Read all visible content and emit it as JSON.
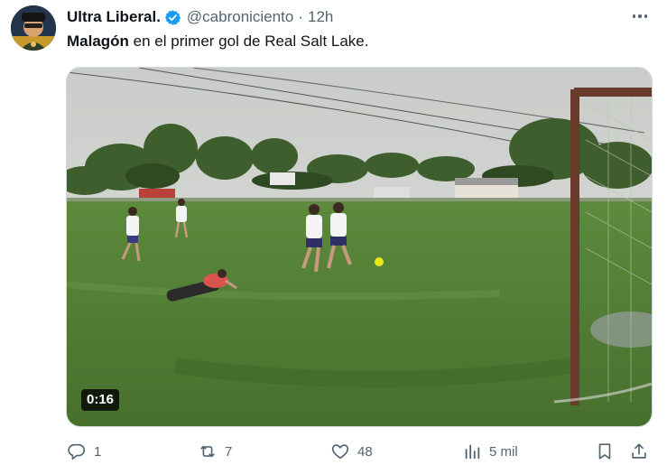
{
  "tweet": {
    "display_name": "Ultra Liberal.",
    "handle": "@cabroniciento",
    "separator": "·",
    "time": "12h",
    "text_bold": "Malagón",
    "text_rest": " en el primer gol de Real Salt Lake."
  },
  "media": {
    "duration": "0:16"
  },
  "actions": {
    "replies": "1",
    "reposts": "7",
    "likes": "48",
    "views": "5 mil"
  },
  "colors": {
    "verified": "#1d9bf0",
    "text_secondary": "#536471",
    "field_green": "#4f7a34"
  },
  "icons": [
    "verified-badge-icon",
    "more-icon",
    "reply-icon",
    "repost-icon",
    "like-icon",
    "views-icon",
    "bookmark-icon",
    "share-icon"
  ]
}
